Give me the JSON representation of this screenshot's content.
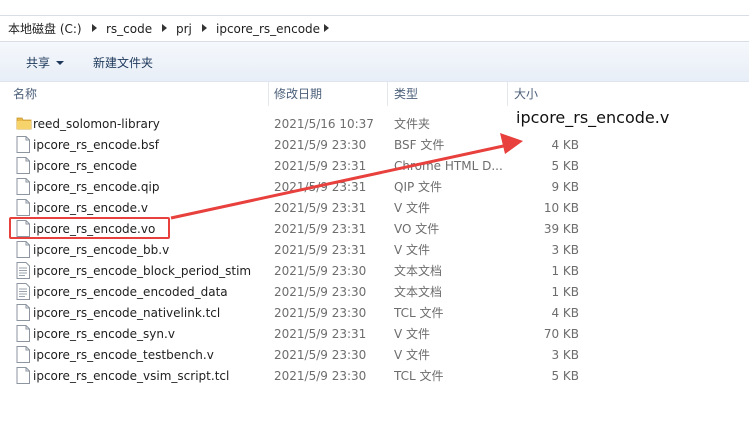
{
  "breadcrumb": {
    "items": [
      "本地磁盘 (C:)",
      "rs_code",
      "prj",
      "ipcore_rs_encode"
    ]
  },
  "toolbar": {
    "share_label": "共享",
    "new_folder_label": "新建文件夹"
  },
  "columns": {
    "name": "名称",
    "date": "修改日期",
    "type": "类型",
    "size": "大小"
  },
  "files": [
    {
      "name": "reed_solomon-library",
      "date": "2021/5/16 10:37",
      "type": "文件夹",
      "size": "",
      "icon": "folder-icon"
    },
    {
      "name": "ipcore_rs_encode.bsf",
      "date": "2021/5/9 23:30",
      "type": "BSF 文件",
      "size": "4 KB",
      "icon": "file-icon"
    },
    {
      "name": "ipcore_rs_encode",
      "date": "2021/5/9 23:31",
      "type": "Chrome HTML D...",
      "size": "5 KB",
      "icon": "file-icon"
    },
    {
      "name": "ipcore_rs_encode.qip",
      "date": "2021/5/9 23:31",
      "type": "QIP 文件",
      "size": "9 KB",
      "icon": "file-icon"
    },
    {
      "name": "ipcore_rs_encode.v",
      "date": "2021/5/9 23:31",
      "type": "V 文件",
      "size": "10 KB",
      "icon": "file-icon"
    },
    {
      "name": "ipcore_rs_encode.vo",
      "date": "2021/5/9 23:31",
      "type": "VO 文件",
      "size": "39 KB",
      "icon": "file-icon"
    },
    {
      "name": "ipcore_rs_encode_bb.v",
      "date": "2021/5/9 23:31",
      "type": "V 文件",
      "size": "3 KB",
      "icon": "file-icon"
    },
    {
      "name": "ipcore_rs_encode_block_period_stim",
      "date": "2021/5/9 23:30",
      "type": "文本文档",
      "size": "1 KB",
      "icon": "text-file-icon"
    },
    {
      "name": "ipcore_rs_encode_encoded_data",
      "date": "2021/5/9 23:30",
      "type": "文本文档",
      "size": "1 KB",
      "icon": "text-file-icon"
    },
    {
      "name": "ipcore_rs_encode_nativelink.tcl",
      "date": "2021/5/9 23:30",
      "type": "TCL 文件",
      "size": "4 KB",
      "icon": "file-icon"
    },
    {
      "name": "ipcore_rs_encode_syn.v",
      "date": "2021/5/9 23:31",
      "type": "V 文件",
      "size": "70 KB",
      "icon": "file-icon"
    },
    {
      "name": "ipcore_rs_encode_testbench.v",
      "date": "2021/5/9 23:30",
      "type": "V 文件",
      "size": "3 KB",
      "icon": "file-icon"
    },
    {
      "name": "ipcore_rs_encode_vsim_script.tcl",
      "date": "2021/5/9 23:30",
      "type": "TCL 文件",
      "size": "5 KB",
      "icon": "file-icon"
    }
  ],
  "annotation": {
    "label": "ipcore_rs_encode.v",
    "color": "#e8403d"
  }
}
